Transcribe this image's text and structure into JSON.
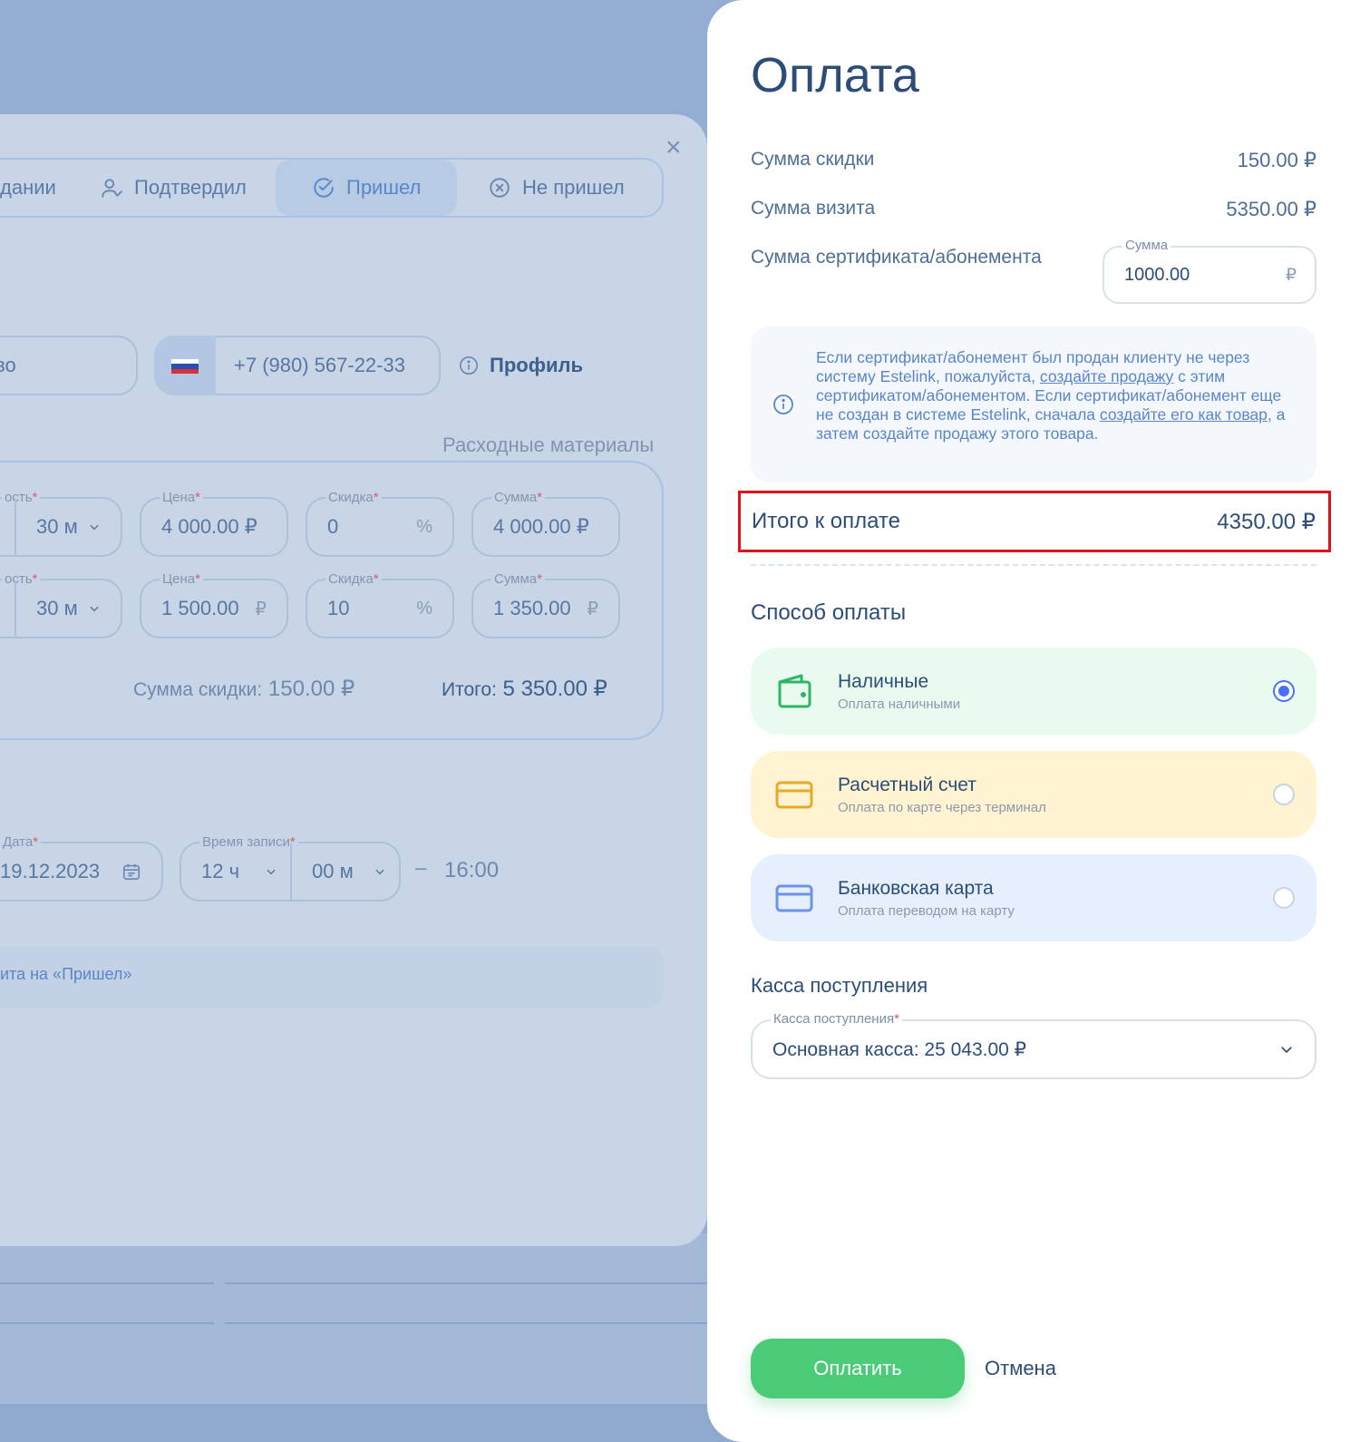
{
  "background": {
    "status_tabs": [
      {
        "label": "дании",
        "icon": "none"
      },
      {
        "label": "Подтвердил",
        "icon": "user-check-icon"
      },
      {
        "label": "Пришел",
        "icon": "check-circle-icon"
      },
      {
        "label": "Не пришел",
        "icon": "x-circle-icon"
      }
    ],
    "client": {
      "name_partial": "тво",
      "phone": "+7 (980) 567-22-33",
      "profile_label": "Профиль"
    },
    "consumables_label": "Расходные материалы",
    "service_rows": [
      {
        "duration_label_partial": "ость",
        "duration": "30 м",
        "price_label": "Цена",
        "price": "4 000.00 ₽",
        "discount_label": "Скидка",
        "discount": "0",
        "discount_unit": "%",
        "sum_label": "Сумма",
        "sum": "4 000.00 ₽"
      },
      {
        "duration_label_partial": "ость",
        "duration": "30 м",
        "price_label": "Цена",
        "price": "1 500.00",
        "price_unit": "₽",
        "discount_label": "Скидка",
        "discount": "10",
        "discount_unit": "%",
        "sum_label": "Сумма",
        "sum": "1 350.00",
        "sum_unit": "₽"
      }
    ],
    "summary": {
      "discount_label": "Сумма скидки:",
      "discount_value": "150.00 ₽",
      "total_label": "Итого:",
      "total_value": "5 350.00 ₽"
    },
    "schedule": {
      "date_label": "Дата",
      "date": "19.12.2023",
      "time_label": "Время записи",
      "hours": "12 ч",
      "minutes": "00 м",
      "dash": "–",
      "end_time": "16:00"
    },
    "note_text": "ита на «Пришел»"
  },
  "payment": {
    "title": "Оплата",
    "discount_label": "Сумма скидки",
    "discount_value": "150.00 ₽",
    "visit_label": "Сумма визита",
    "visit_value": "5350.00 ₽",
    "certificate_label": "Сумма сертификата/абонемента",
    "certificate_input_label": "Сумма",
    "certificate_input_value": "1000.00",
    "certificate_currency": "₽",
    "info": {
      "part1": "Если сертификат/абонемент был продан клиенту не через систему Estelink, пожалуйста, ",
      "link1": "создайте продажу",
      "part2": " с этим сертификатом/абонементом. Если сертификат/абонемент еще не создан в системе Estelink, сначала ",
      "link2": "создайте его как товар",
      "part3": ", а затем создайте продажу этого товара."
    },
    "total_label": "Итого к оплате",
    "total_value": "4350.00 ₽",
    "method_heading": "Способ оплаты",
    "methods": [
      {
        "title": "Наличные",
        "subtitle": "Оплата наличными",
        "icon": "wallet-icon",
        "bg": "#e9fbef",
        "color": "#2fb566",
        "selected": true
      },
      {
        "title": "Расчетный счет",
        "subtitle": "Оплата по карте через терминал",
        "icon": "credit-card-icon",
        "bg": "#fff3d1",
        "color": "#e6a92a",
        "selected": false
      },
      {
        "title": "Банковская карта",
        "subtitle": "Оплата переводом на карту",
        "icon": "bank-card-icon",
        "bg": "#e5effd",
        "color": "#6b93e8",
        "selected": false
      }
    ],
    "cashbox_heading": "Касса поступления",
    "cashbox_label": "Касса поступления",
    "cashbox_value": "Основная касса: 25 043.00 ₽",
    "pay_button": "Оплатить",
    "cancel_button": "Отмена"
  }
}
